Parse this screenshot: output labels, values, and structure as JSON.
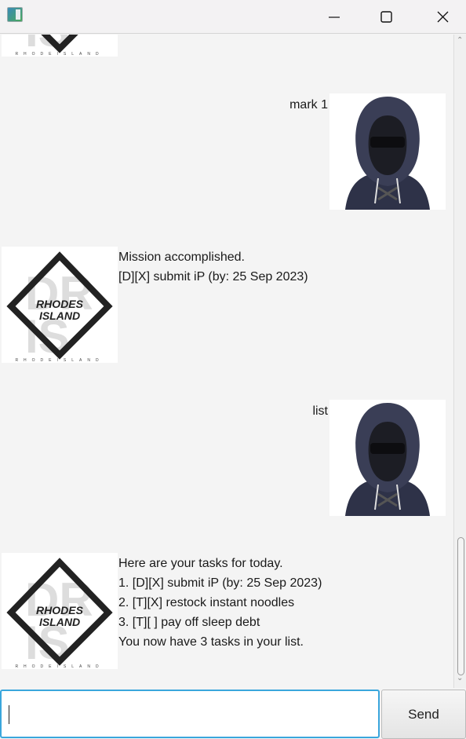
{
  "window": {
    "title": ""
  },
  "messages": [
    {
      "sender": "bot",
      "lines": []
    },
    {
      "sender": "user",
      "text": "mark 1"
    },
    {
      "sender": "bot",
      "lines": [
        "Mission accomplished.",
        "[D][X] submit iP (by: 25 Sep 2023)"
      ]
    },
    {
      "sender": "user",
      "text": "list"
    },
    {
      "sender": "bot",
      "lines": [
        "Here are your tasks for today.",
        "1. [D][X] submit iP (by: 25 Sep 2023)",
        "2. [T][X] restock instant noodles",
        "3. [T][ ] pay off sleep debt",
        "You now have 3 tasks in your list."
      ]
    }
  ],
  "bot_logo": {
    "top": "RHODES",
    "bottom": "ISLAND",
    "footer": "RHODEISLAND"
  },
  "input": {
    "value": ""
  },
  "send_label": "Send",
  "colors": {
    "accent": "#3aa6dc"
  }
}
